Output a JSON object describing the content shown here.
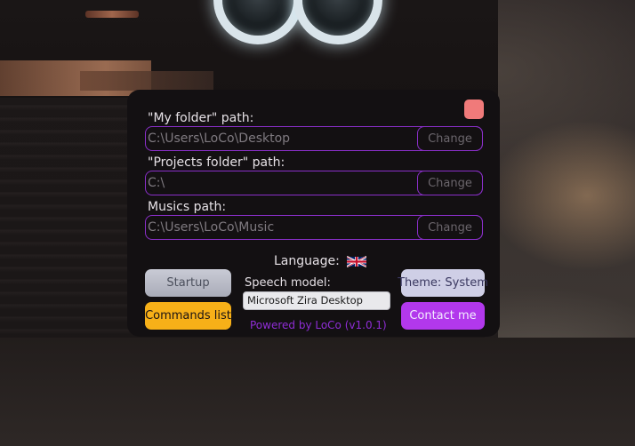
{
  "settings": {
    "my_folder": {
      "label": "\"My folder\" path:",
      "value": "C:\\Users\\LoCo\\Desktop",
      "change_label": "Change"
    },
    "projects_folder": {
      "label": "\"Projects folder\" path:",
      "value": "C:\\",
      "change_label": "Change"
    },
    "musics": {
      "label": "Musics path:",
      "value": "C:\\Users\\LoCo\\Music",
      "change_label": "Change"
    },
    "language": {
      "label": "Language:",
      "flag_icon": "uk-flag-icon"
    },
    "buttons": {
      "startup": "Startup",
      "commands": "Commands list",
      "theme": "Theme: System",
      "contact": "Contact me"
    },
    "speech_model": {
      "label": "Speech model:",
      "selected": "Microsoft Zira Desktop"
    },
    "powered_by": "Powered by LoCo (v1.0.1)",
    "close_icon": "close-icon"
  },
  "colors": {
    "accent_purple": "#b238ec",
    "border_purple": "#8a2fc9",
    "close_red": "#f07a7a",
    "commands_orange": "#f7b018",
    "window_bg": "#131012"
  }
}
